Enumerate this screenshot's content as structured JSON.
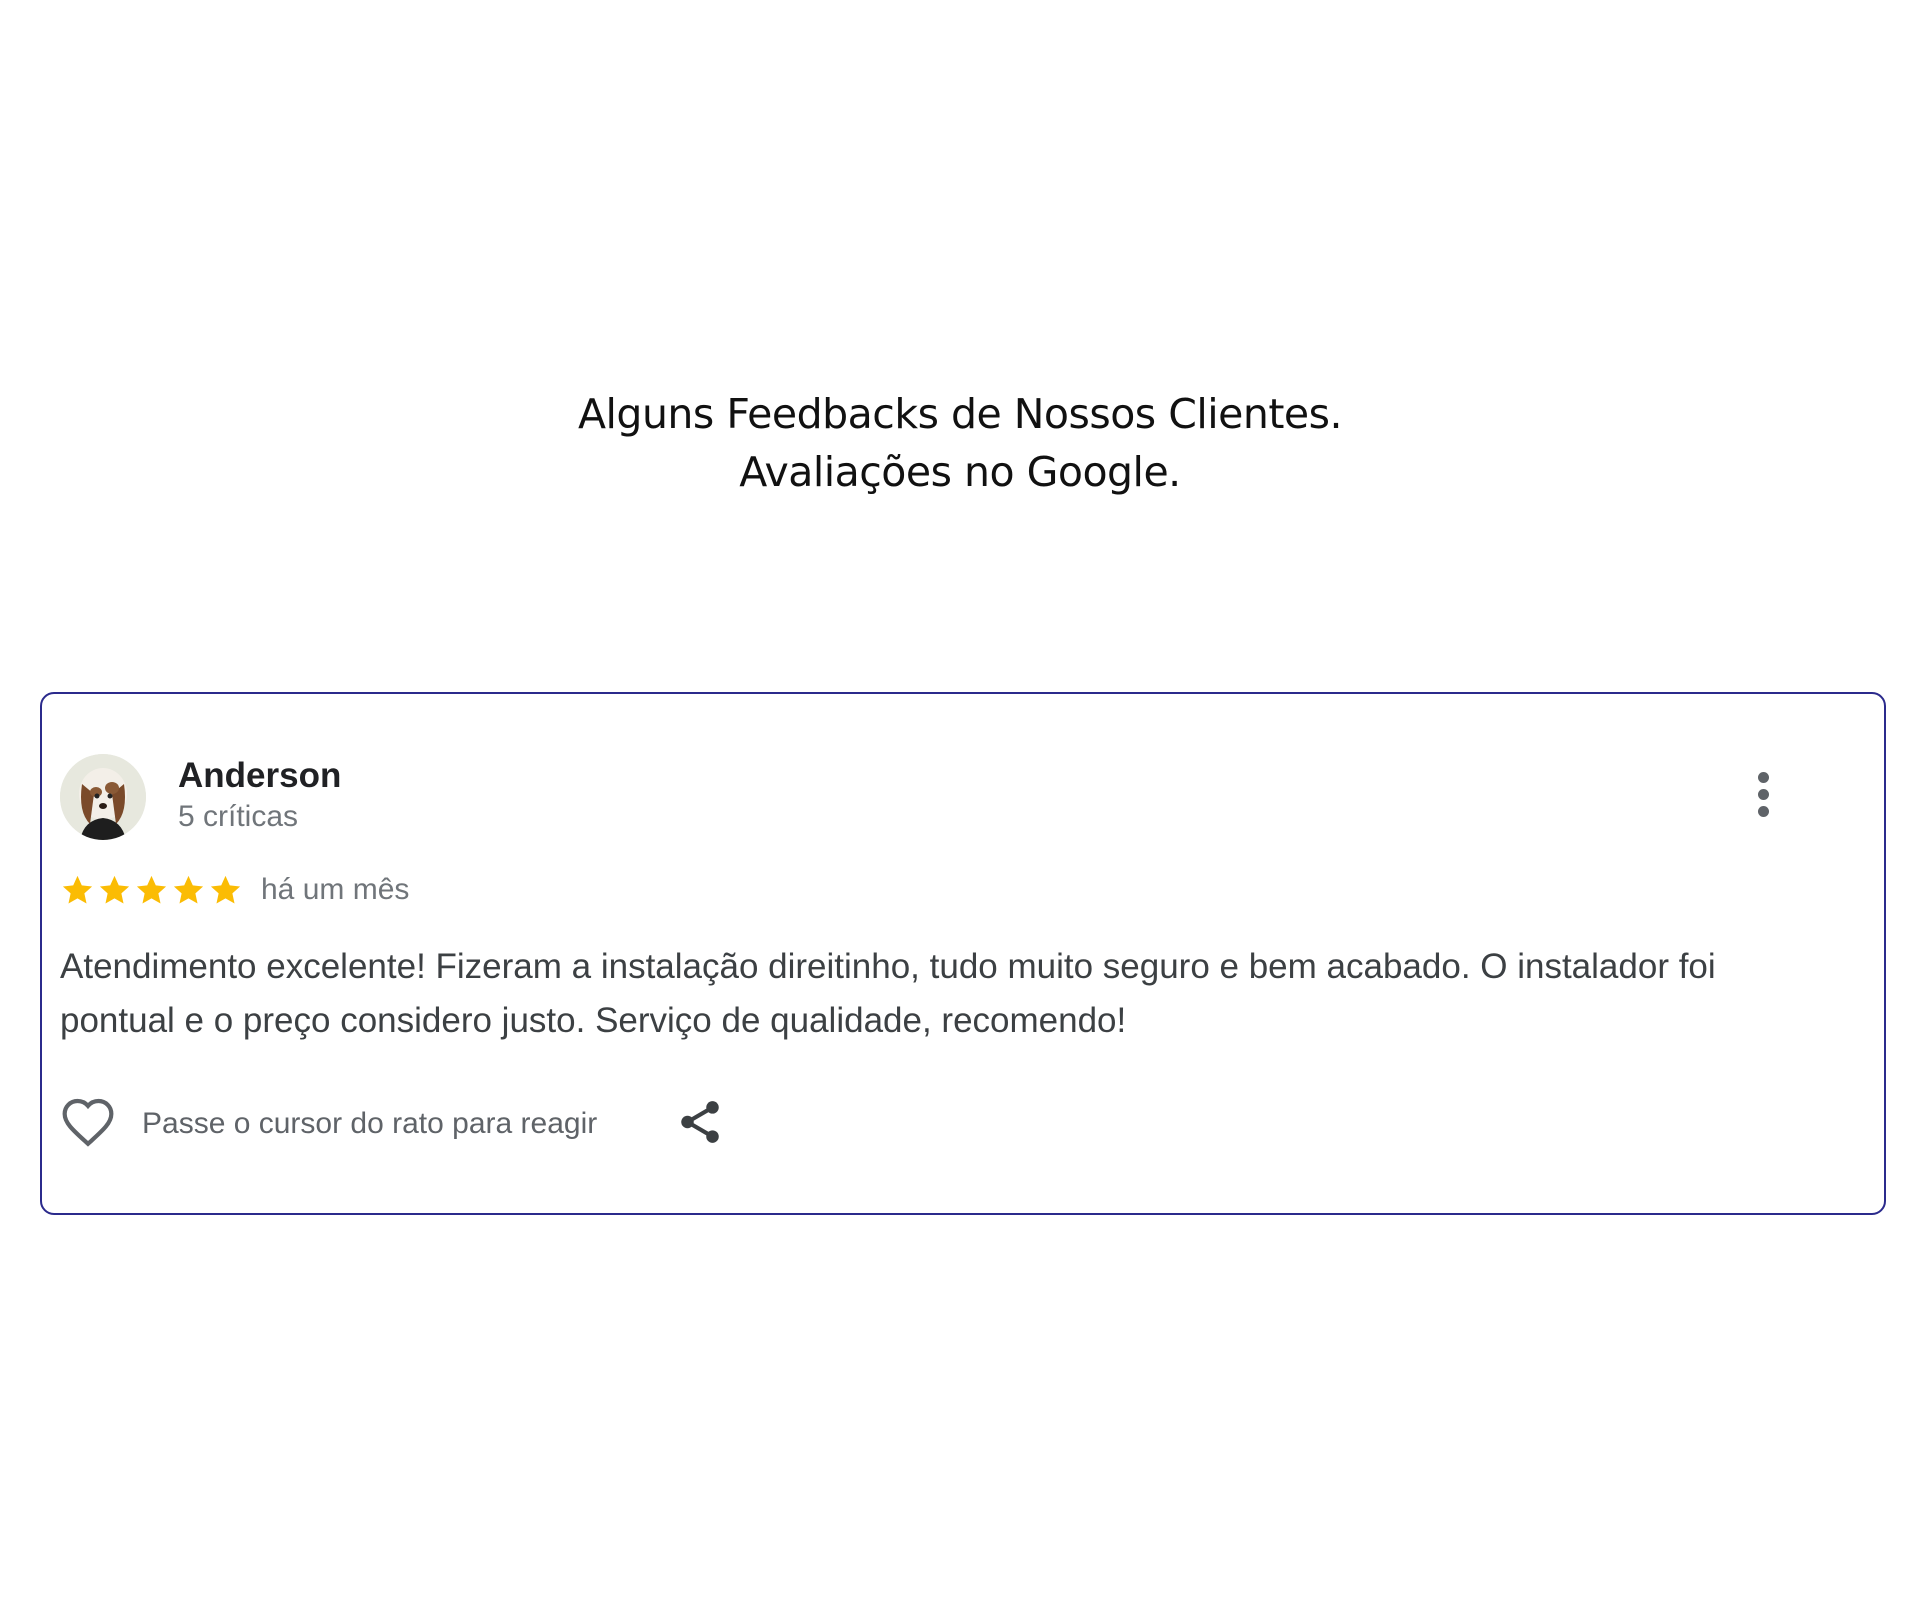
{
  "heading": {
    "line1": "Alguns Feedbacks de Nossos Clientes.",
    "line2": "Avaliações no Google."
  },
  "review": {
    "reviewer_name": "Anderson",
    "reviewer_meta": "5 críticas",
    "rating": 5,
    "rating_max": 5,
    "date": "há um mês",
    "text": "Atendimento excelente! Fizeram a instalação direitinho, tudo muito seguro e bem acabado. O instalador foi pontual e o preço considero justo. Serviço de qualidade, recomendo!",
    "react_hint": "Passe o cursor do rato para reagir",
    "icons": {
      "avatar": "avatar-photo",
      "menu": "more-vertical-icon",
      "star": "star-icon",
      "heart": "heart-icon",
      "share": "share-icon"
    }
  },
  "colors": {
    "card_border": "#2b2a8c",
    "star": "#fbbc04",
    "text_primary": "#202124",
    "text_secondary": "#70757a"
  }
}
